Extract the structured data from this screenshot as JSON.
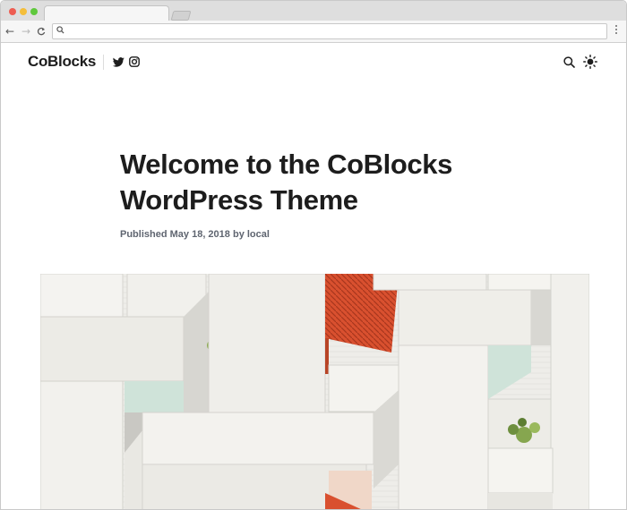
{
  "browser": {
    "url": "",
    "icons": {
      "back": "arrow-left-icon",
      "forward": "arrow-right-icon",
      "reload": "reload-icon",
      "search": "search-icon",
      "menu": "kebab-menu-icon"
    },
    "colors": {
      "close": "#ee5d52",
      "minimize": "#f4be3b",
      "maximize": "#5fc83c"
    }
  },
  "site": {
    "title": "CoBlocks",
    "social": [
      "twitter-icon",
      "instagram-icon"
    ],
    "header_icons": [
      "search-icon",
      "sun-icon"
    ]
  },
  "post": {
    "title": "Welcome to the CoBlocks WordPress Theme",
    "meta": {
      "published_label": "Published",
      "date": "May 18, 2018",
      "by_label": "by",
      "author": "local"
    },
    "featured_image": "white-concrete-balconies-with-plants-and-orange-shutter"
  },
  "colors": {
    "text": "#1d1d1d",
    "meta": "#5f6570",
    "accent_orange": "#d9502f"
  }
}
